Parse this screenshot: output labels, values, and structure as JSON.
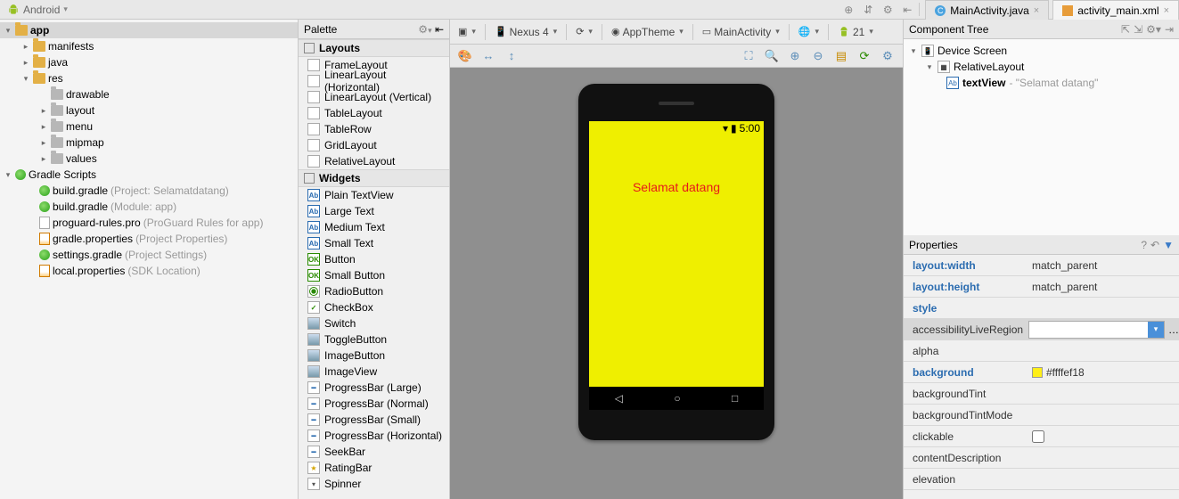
{
  "tabs": {
    "android_label": "Android",
    "file1": "MainActivity.java",
    "file2": "activity_main.xml"
  },
  "project": {
    "root": "app",
    "items": [
      {
        "indent": 1,
        "arrow": "▸",
        "icon": "folder",
        "label": "manifests"
      },
      {
        "indent": 1,
        "arrow": "▸",
        "icon": "folder",
        "label": "java"
      },
      {
        "indent": 1,
        "arrow": "▾",
        "icon": "folder",
        "label": "res"
      },
      {
        "indent": 2,
        "arrow": "",
        "icon": "folder-grey",
        "label": "drawable"
      },
      {
        "indent": 2,
        "arrow": "▸",
        "icon": "folder-grey",
        "label": "layout"
      },
      {
        "indent": 2,
        "arrow": "▸",
        "icon": "folder-grey",
        "label": "menu"
      },
      {
        "indent": 2,
        "arrow": "▸",
        "icon": "folder-grey",
        "label": "mipmap"
      },
      {
        "indent": 2,
        "arrow": "▸",
        "icon": "folder-grey",
        "label": "values"
      }
    ],
    "gradle_root": "Gradle Scripts",
    "gradle_items": [
      {
        "icon": "gradle",
        "label": "build.gradle",
        "note": "(Project: Selamatdatang)"
      },
      {
        "icon": "gradle",
        "label": "build.gradle",
        "note": "(Module: app)"
      },
      {
        "icon": "file",
        "label": "proguard-rules.pro",
        "note": "(ProGuard Rules for app)"
      },
      {
        "icon": "props",
        "label": "gradle.properties",
        "note": "(Project Properties)"
      },
      {
        "icon": "gradle",
        "label": "settings.gradle",
        "note": "(Project Settings)"
      },
      {
        "icon": "props",
        "label": "local.properties",
        "note": "(SDK Location)"
      }
    ]
  },
  "palette": {
    "title": "Palette",
    "group_layouts": "Layouts",
    "layouts": [
      "FrameLayout",
      "LinearLayout (Horizontal)",
      "LinearLayout (Vertical)",
      "TableLayout",
      "TableRow",
      "GridLayout",
      "RelativeLayout"
    ],
    "group_widgets": "Widgets",
    "widgets": [
      {
        "ico": "ab",
        "label": "Plain TextView"
      },
      {
        "ico": "ab",
        "label": "Large Text"
      },
      {
        "ico": "ab",
        "label": "Medium Text"
      },
      {
        "ico": "ab",
        "label": "Small Text"
      },
      {
        "ico": "ok",
        "label": "Button"
      },
      {
        "ico": "ok",
        "label": "Small Button"
      },
      {
        "ico": "radio",
        "label": "RadioButton"
      },
      {
        "ico": "check",
        "label": "CheckBox"
      },
      {
        "ico": "img",
        "label": "Switch"
      },
      {
        "ico": "img",
        "label": "ToggleButton"
      },
      {
        "ico": "img",
        "label": "ImageButton"
      },
      {
        "ico": "img",
        "label": "ImageView"
      },
      {
        "ico": "bar",
        "label": "ProgressBar (Large)"
      },
      {
        "ico": "bar",
        "label": "ProgressBar (Normal)"
      },
      {
        "ico": "bar",
        "label": "ProgressBar (Small)"
      },
      {
        "ico": "bar",
        "label": "ProgressBar (Horizontal)"
      },
      {
        "ico": "bar",
        "label": "SeekBar"
      },
      {
        "ico": "star",
        "label": "RatingBar"
      },
      {
        "ico": "sel",
        "label": "Spinner"
      }
    ]
  },
  "toolbar": {
    "device": "Nexus 4",
    "theme": "AppTheme",
    "activity": "MainActivity",
    "api": "21"
  },
  "phone": {
    "status_time": "5:00",
    "text": "Selamat datang"
  },
  "component_tree": {
    "title": "Component Tree",
    "root": "Device Screen",
    "layout": "RelativeLayout",
    "item": "textView",
    "item_note": "- \"Selamat datang\""
  },
  "properties": {
    "title": "Properties",
    "rows": [
      {
        "key": "layout:width",
        "bold": true,
        "val": "match_parent"
      },
      {
        "key": "layout:height",
        "bold": true,
        "val": "match_parent"
      },
      {
        "key": "style",
        "bold": true,
        "val": ""
      },
      {
        "key": "accessibilityLiveRegion",
        "bold": false,
        "sel": true,
        "combo": true,
        "val": ""
      },
      {
        "key": "alpha",
        "bold": false,
        "val": ""
      },
      {
        "key": "background",
        "bold": true,
        "swatch": true,
        "val": "#ffffef18"
      },
      {
        "key": "backgroundTint",
        "bold": false,
        "val": ""
      },
      {
        "key": "backgroundTintMode",
        "bold": false,
        "val": ""
      },
      {
        "key": "clickable",
        "bold": false,
        "check": true,
        "val": ""
      },
      {
        "key": "contentDescription",
        "bold": false,
        "val": ""
      },
      {
        "key": "elevation",
        "bold": false,
        "val": ""
      }
    ]
  }
}
